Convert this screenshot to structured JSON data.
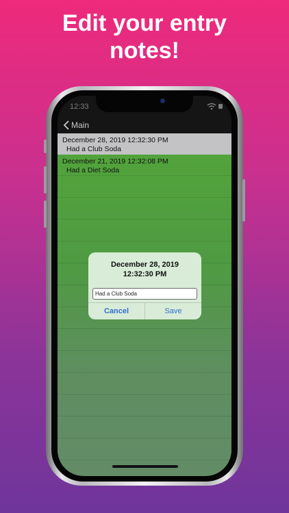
{
  "headline": {
    "line1": "Edit your entry",
    "line2": "notes!"
  },
  "status_bar": {
    "time": "12:33",
    "wifi_icon": "wifi-icon"
  },
  "navbar": {
    "back_label": "Main",
    "back_icon": "chevron-left-icon"
  },
  "entries": [
    {
      "date": "December 28, 2019 12:32:30 PM",
      "note": "Had a Club Soda",
      "selected": true
    },
    {
      "date": "December 21, 2019 12:32:08 PM",
      "note": "Had a Diet Soda",
      "selected": false
    }
  ],
  "dialog": {
    "title_line1": "December 28, 2019",
    "title_line2": "12:32:30 PM",
    "input_value": "Had a Club Soda",
    "cancel_label": "Cancel",
    "save_label": "Save"
  },
  "colors": {
    "background_top": "#ee2a7b",
    "background_bottom": "#6f359b",
    "list_green": "#52a53a",
    "selected_row": "#c3c3c5",
    "dialog_bg": "#d9ecd8",
    "button_blue": "#2f6fce"
  }
}
